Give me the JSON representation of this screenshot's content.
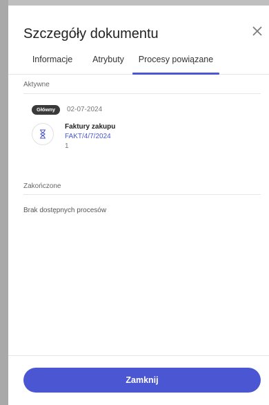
{
  "dialog": {
    "title": "Szczegóły dokumentu",
    "close_icon": "close-icon"
  },
  "tabs": [
    {
      "label": "Informacje",
      "active": false
    },
    {
      "label": "Atrybuty",
      "active": false
    },
    {
      "label": "Procesy powiązane",
      "active": true
    }
  ],
  "active_section": {
    "label": "Aktywne",
    "process": {
      "badge": "Główny",
      "date": "02-07-2024",
      "icon": "hourglass-icon",
      "name": "Faktury zakupu",
      "number": "FAKT/4/7/2024",
      "count": "1"
    }
  },
  "finished_section": {
    "label": "Zakończone",
    "empty_text": "Brak dostępnych procesów"
  },
  "footer": {
    "close_button": "Zamknij"
  },
  "colors": {
    "accent": "#4b56d2",
    "badge_bg": "#3a3a3a"
  }
}
